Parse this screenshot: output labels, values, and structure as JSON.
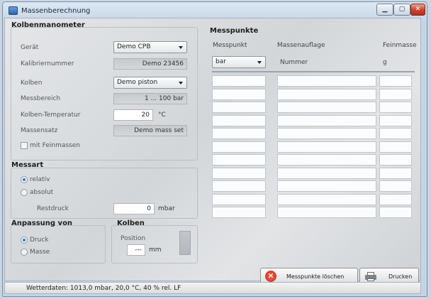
{
  "window": {
    "title": "Massenberechnung"
  },
  "kolben_manometer": {
    "title": "Kolbenmanometer",
    "geraet_label": "Gerät",
    "geraet_value": "Demo CPB",
    "kalibriernummer_label": "Kalibriernummer",
    "kalibriernummer_value": "Demo 23456",
    "kolben_label": "Kolben",
    "kolben_value": "Demo piston",
    "messbereich_label": "Messbereich",
    "messbereich_value": "1 ... 100 bar",
    "temperatur_label": "Kolben-Temperatur",
    "temperatur_value": "20",
    "temperatur_unit": "°C",
    "massensatz_label": "Massensatz",
    "massensatz_value": "Demo mass set",
    "feinmassen_label": "mit Feinmassen"
  },
  "messart": {
    "title": "Messart",
    "relativ_label": "relativ",
    "absolut_label": "absolut",
    "restdruck_label": "Restdruck",
    "restdruck_value": "0",
    "restdruck_unit": "mbar"
  },
  "anpassung": {
    "title": "Anpassung von",
    "druck_label": "Druck",
    "masse_label": "Masse"
  },
  "kolben": {
    "title": "Kolben",
    "position_label": "Position",
    "position_value": "---",
    "position_unit": "mm"
  },
  "messpunkte": {
    "title": "Messpunkte",
    "col_messpunkt": "Messpunkt",
    "col_massenauflage": "Massenauflage",
    "col_feinmasse": "Feinmasse",
    "unit_select": "bar",
    "sub_massenauflage": "Nummer",
    "sub_feinmasse": "g"
  },
  "buttons": {
    "delete": "Messpunkte löschen",
    "print": "Drucken"
  },
  "status": {
    "text": "Wetterdaten: 1013,0 mbar, 20,0 °C, 40 % rel. LF"
  }
}
